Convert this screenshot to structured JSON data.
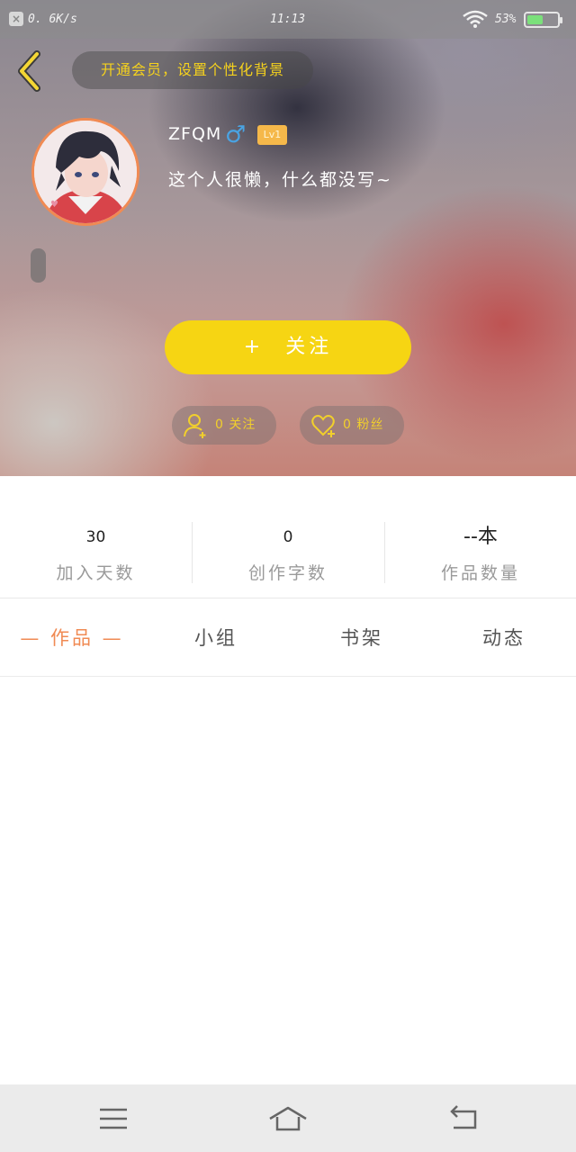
{
  "status_bar": {
    "network_speed": "0. 6K/s",
    "time": "11:13",
    "battery_percent": "53%",
    "battery_level": 0.53
  },
  "header": {
    "vip_banner": "开通会员，设置个性化背景",
    "username": "ZFQM",
    "gender_symbol": "♂",
    "level": "Lv1",
    "bio": "这个人很懒，什么都没写~",
    "follow_button": {
      "plus": "+",
      "label": "关注"
    },
    "following": "0 关注",
    "fans": "0 粉丝"
  },
  "stats": [
    {
      "value": "30",
      "label": "加入天数"
    },
    {
      "value": "0",
      "label": "创作字数"
    },
    {
      "value": "--本",
      "label": "作品数量"
    }
  ],
  "tabs": [
    {
      "label": "— 作品 —",
      "active": true
    },
    {
      "label": "小组",
      "active": false
    },
    {
      "label": "书架",
      "active": false
    },
    {
      "label": "动态",
      "active": false
    }
  ],
  "colors": {
    "accent_orange": "#f08a53",
    "follow_yellow": "#f6d513",
    "banner_text_yellow": "#f6d21d",
    "gender_blue": "#4aa3e2",
    "level_badge": "#f5b84a"
  },
  "icons": {
    "back": "chevron-left-icon",
    "add_user": "add-user-icon",
    "heart_plus": "heart-plus-icon",
    "nav_menu": "menu-icon",
    "nav_home": "home-icon",
    "nav_back": "return-icon"
  }
}
